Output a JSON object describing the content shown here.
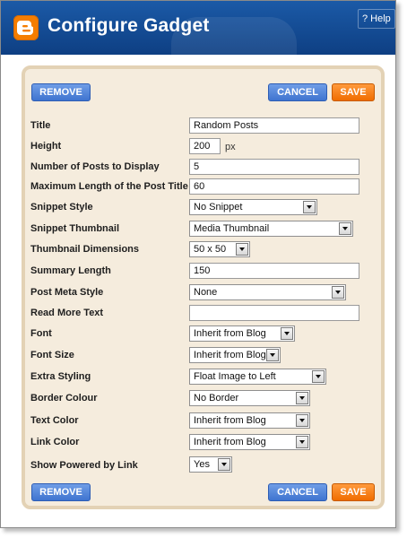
{
  "header": {
    "title": "Configure Gadget",
    "help_label": "? Help"
  },
  "buttons": {
    "remove": "REMOVE",
    "cancel": "CANCEL",
    "save": "SAVE"
  },
  "form": {
    "title": {
      "label": "Title",
      "value": "Random Posts"
    },
    "height": {
      "label": "Height",
      "value": "200",
      "unit": "px"
    },
    "num_posts": {
      "label": "Number of Posts to Display",
      "value": "5"
    },
    "max_title_len": {
      "label": "Maximum Length of the Post Title",
      "value": "60"
    },
    "snippet_style": {
      "label": "Snippet Style",
      "value": "No Snippet"
    },
    "snippet_thumb": {
      "label": "Snippet Thumbnail",
      "value": "Media Thumbnail"
    },
    "thumb_dims": {
      "label": "Thumbnail Dimensions",
      "value": "50 x 50"
    },
    "summary_len": {
      "label": "Summary Length",
      "value": "150"
    },
    "post_meta": {
      "label": "Post Meta Style",
      "value": "None"
    },
    "read_more": {
      "label": "Read More Text",
      "value": ""
    },
    "font": {
      "label": "Font",
      "value": "Inherit from Blog"
    },
    "font_size": {
      "label": "Font Size",
      "value": "Inherit from Blog"
    },
    "extra_styling": {
      "label": "Extra Styling",
      "value": "Float Image to Left"
    },
    "border_colour": {
      "label": "Border Colour",
      "value": "No Border"
    },
    "text_color": {
      "label": "Text Color",
      "value": "Inherit from Blog"
    },
    "link_color": {
      "label": "Link Color",
      "value": "Inherit from Blog"
    },
    "powered_by": {
      "label": "Show Powered by Link",
      "value": "Yes"
    }
  }
}
